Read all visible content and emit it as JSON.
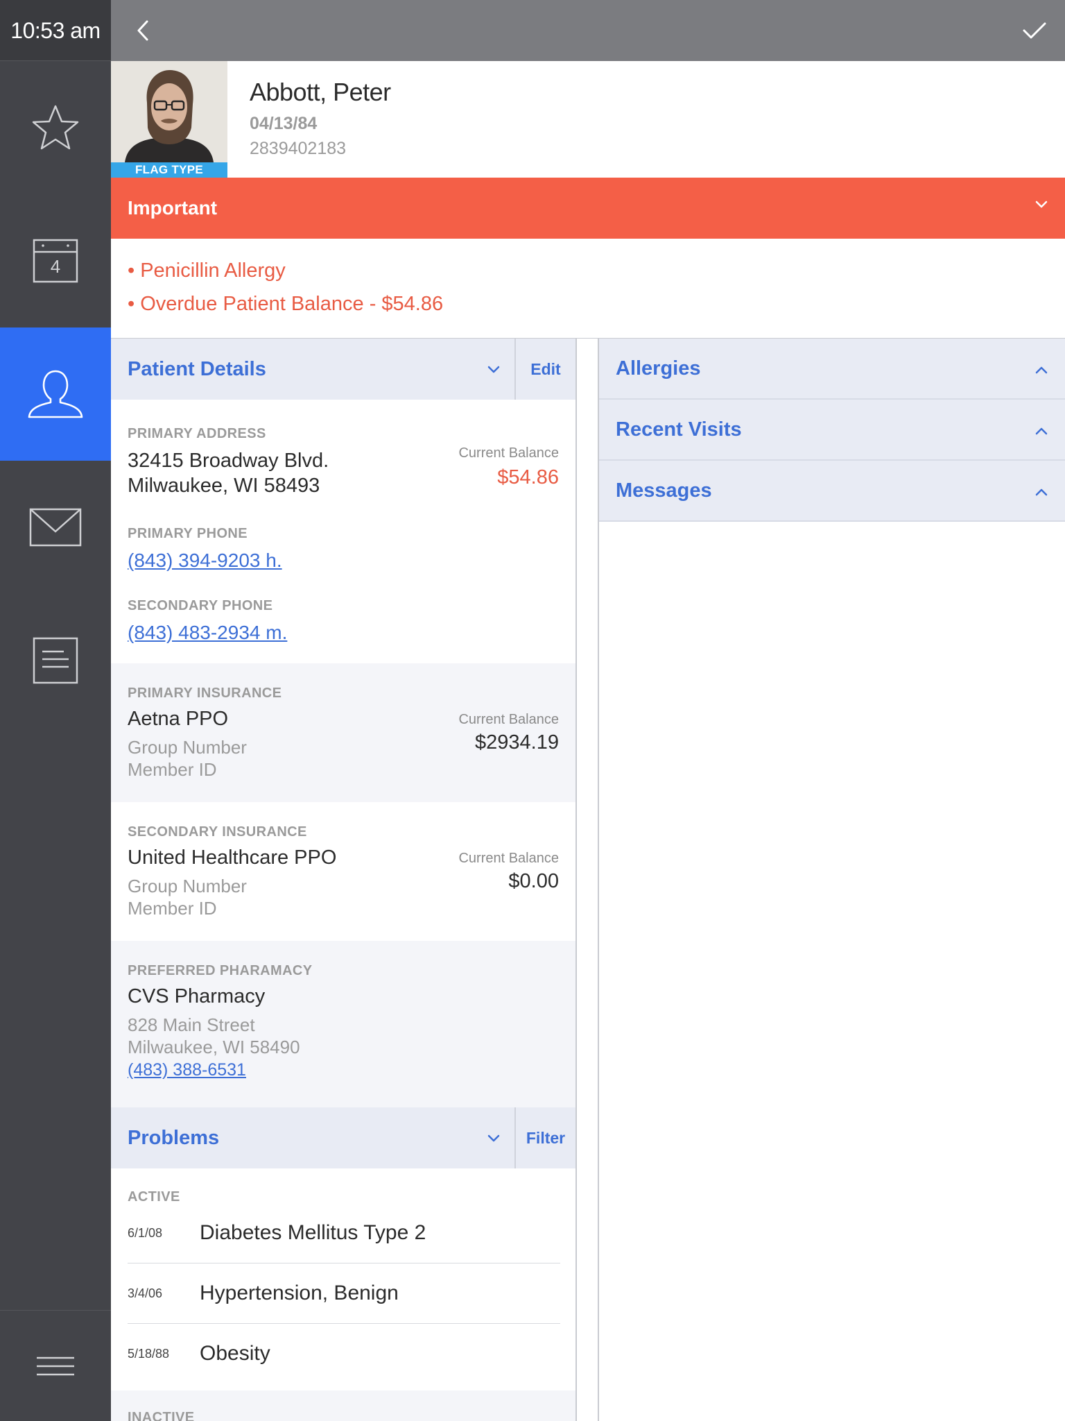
{
  "status": {
    "time": "10:53 am"
  },
  "nav": {
    "items": [
      {
        "icon": "star-icon",
        "active": false
      },
      {
        "icon": "calendar-icon",
        "badge": "4",
        "active": false
      },
      {
        "icon": "person-icon",
        "active": true
      },
      {
        "icon": "mail-icon",
        "active": false
      },
      {
        "icon": "document-icon",
        "active": false
      }
    ],
    "menu_icon": "hamburger-menu-icon"
  },
  "topbar": {
    "back_icon": "chevron-left-icon",
    "done_icon": "checkmark-icon"
  },
  "patient": {
    "name": "Abbott, Peter",
    "dob": "04/13/84",
    "id": "2839402183",
    "flag": "FLAG TYPE"
  },
  "important": {
    "label": "Important",
    "alerts": [
      "• Penicillin Allergy",
      "• Overdue Patient Balance - $54.86"
    ]
  },
  "patient_details": {
    "title": "Patient Details",
    "action": "Edit",
    "primary_address_label": "PRIMARY ADDRESS",
    "address_line1": "32415 Broadway Blvd.",
    "address_line2": "Milwaukee, WI 58493",
    "balance_label": "Current Balance",
    "balance_value": "$54.86",
    "primary_phone_label": "PRIMARY PHONE",
    "primary_phone": "(843) 394-9203 h.",
    "secondary_phone_label": "SECONDARY PHONE",
    "secondary_phone": "(843) 483-2934 m."
  },
  "primary_insurance": {
    "label": "PRIMARY INSURANCE",
    "name": "Aetna PPO",
    "group": "Group Number",
    "member": "Member ID",
    "balance_label": "Current Balance",
    "balance_value": "$2934.19"
  },
  "secondary_insurance": {
    "label": "SECONDARY INSURANCE",
    "name": "United Healthcare PPO",
    "group": "Group Number",
    "member": "Member ID",
    "balance_label": "Current Balance",
    "balance_value": "$0.00"
  },
  "pharmacy": {
    "label": "PREFERRED PHARAMACY",
    "name": "CVS Pharmacy",
    "street": "828 Main Street",
    "city": "Milwaukee, WI 58490",
    "phone": "(483) 388-6531"
  },
  "problems": {
    "title": "Problems",
    "action": "Filter",
    "active_label": "ACTIVE",
    "items": [
      {
        "date": "6/1/08",
        "name": "Diabetes Mellitus Type 2"
      },
      {
        "date": "3/4/06",
        "name": "Hypertension, Benign"
      },
      {
        "date": "5/18/88",
        "name": "Obesity"
      }
    ],
    "inactive_label": "INACTIVE"
  },
  "right_sections": [
    "Allergies",
    "Recent Visits",
    "Messages"
  ],
  "colors": {
    "rail": "#434449",
    "active_nav": "#2f6df3",
    "topbar": "#7b7c80",
    "alert": "#f45f47",
    "flag": "#35a6e8",
    "link": "#3d6fd6"
  }
}
